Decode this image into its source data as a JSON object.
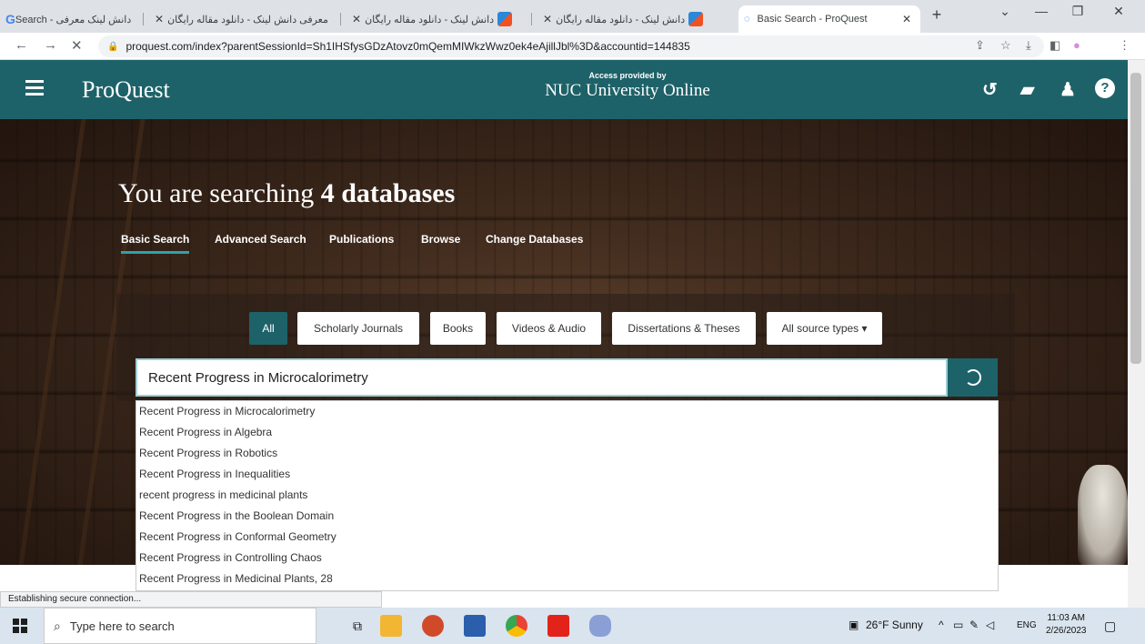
{
  "browser": {
    "tabs": [
      {
        "label": "Search - دانش لینک معرفی",
        "favicon": "google-icon"
      },
      {
        "label": "معرفی دانش لینک - دانلود مقاله رایگان",
        "favicon": "danesh-link-icon"
      },
      {
        "label": "دانش لینک - دانلود مقاله رایگان",
        "favicon": "danesh-link-icon"
      },
      {
        "label": "دانش لینک - دانلود مقاله رایگان",
        "favicon": "danesh-link-icon"
      },
      {
        "label": "Basic Search - ProQuest",
        "favicon": "loading-icon"
      }
    ],
    "url": "proquest.com/index?parentSessionId=Sh1IHSfysGDzAtovz0mQemMIWkzWwz0ek4eAjillJbl%3D&accountid=144835",
    "status_text": "Establishing secure connection..."
  },
  "header": {
    "logo": "ProQuest",
    "access_label": "Access provided by",
    "institution": "NUC University Online"
  },
  "hero": {
    "headline_prefix": "You are searching ",
    "headline_bold": "4 databases",
    "subnav": [
      "Basic Search",
      "Advanced Search",
      "Publications",
      "Browse",
      "Change Databases"
    ],
    "source_types": [
      "All",
      "Scholarly Journals",
      "Books",
      "Videos & Audio",
      "Dissertations & Theses",
      "All source types ▾"
    ]
  },
  "search": {
    "value": "Recent Progress in Microcalorimetry",
    "suggestions": [
      "Recent Progress in Microcalorimetry",
      "Recent Progress in Algebra",
      "Recent Progress in Robotics",
      "Recent Progress in Inequalities",
      "recent progress in medicinal plants",
      "Recent Progress in the Boolean Domain",
      "Recent Progress in Conformal Geometry",
      "Recent Progress in Controlling Chaos",
      "Recent Progress in Medicinal Plants, 28"
    ]
  },
  "taskbar": {
    "search_placeholder": "Type here to search",
    "weather": "26°F  Sunny",
    "language": "ENG",
    "time": "11:03 AM",
    "date": "2/26/2023"
  },
  "colors": {
    "brand_teal": "#1e6269",
    "accent_underline": "#2aa3ad"
  }
}
